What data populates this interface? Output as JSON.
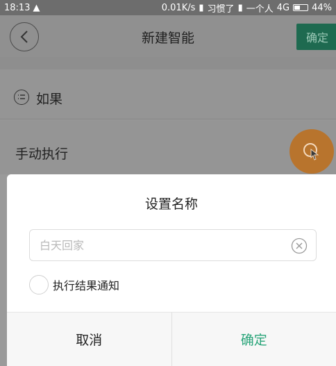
{
  "statusbar": {
    "time": "18:13",
    "speed": "0.01K/s",
    "carrier1": "习惯了",
    "carrier2": "一个人",
    "network": "4G",
    "battery": "44%"
  },
  "header": {
    "title": "新建智能",
    "confirm_label": "确定"
  },
  "condition": {
    "label": "如果"
  },
  "manual": {
    "label": "手动执行"
  },
  "dialog": {
    "title": "设置名称",
    "name_placeholder": "白天回家",
    "notify_label": "执行结果通知",
    "cancel_label": "取消",
    "ok_label": "确定"
  },
  "colors": {
    "accent_green": "#2aa57a",
    "float_button": "#b8742d"
  }
}
